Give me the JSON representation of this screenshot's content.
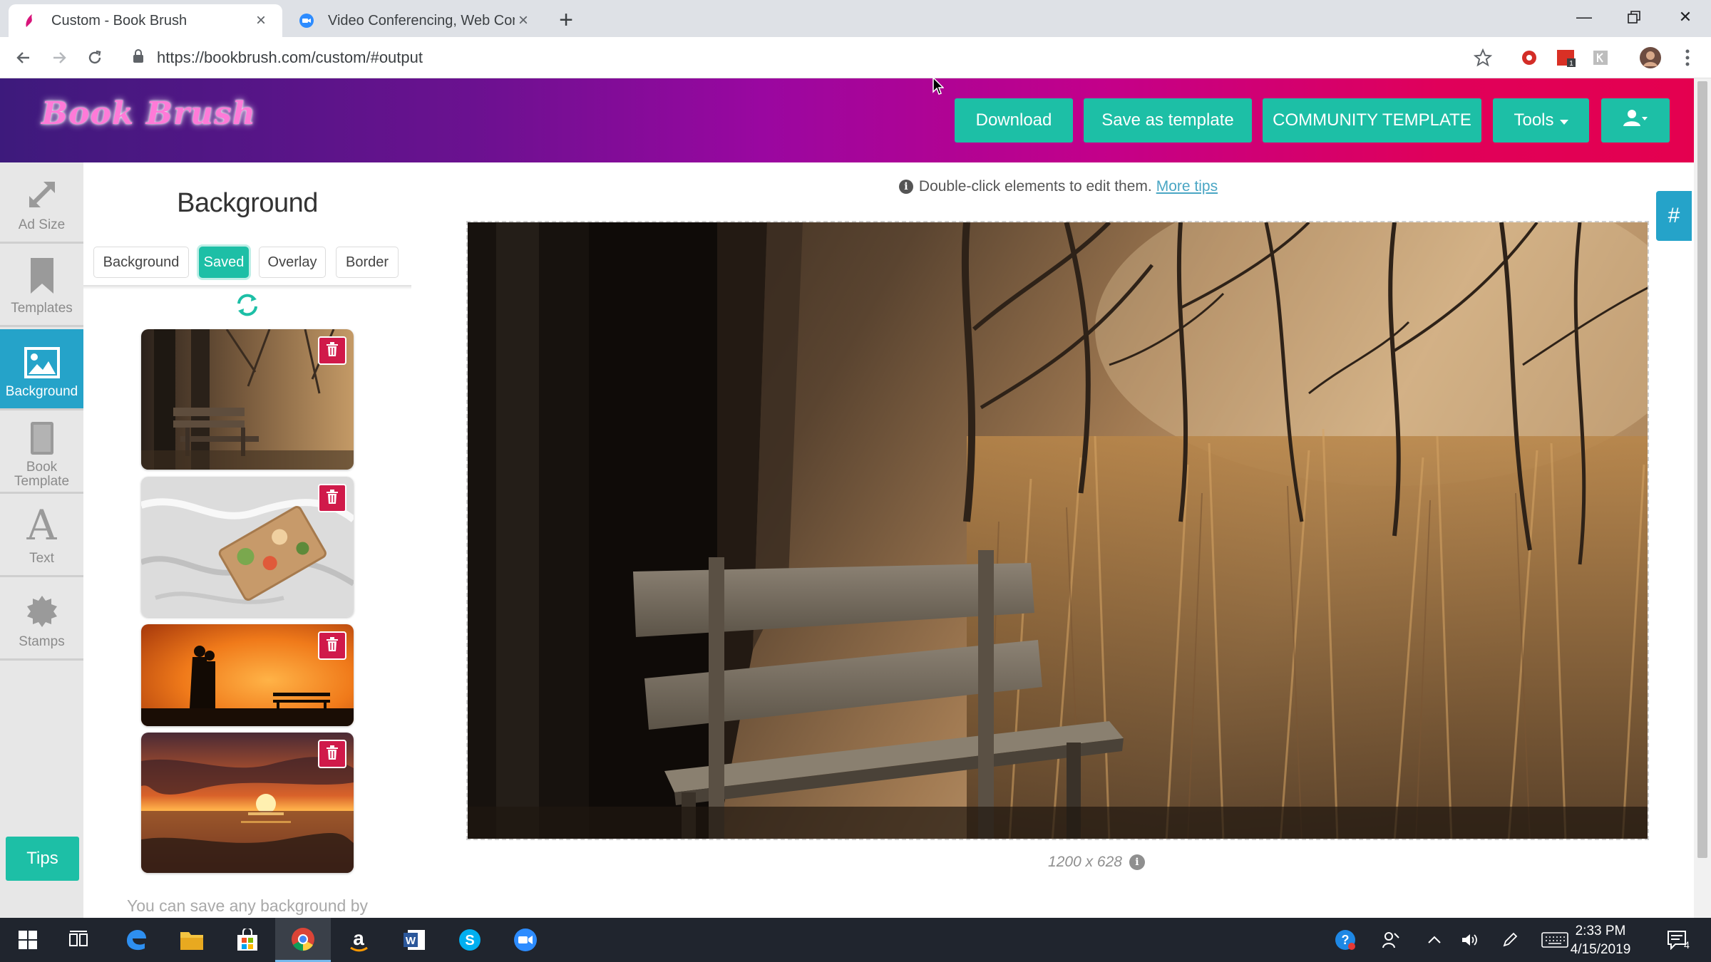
{
  "browser": {
    "tabs": [
      {
        "title": "Custom - Book Brush",
        "active": true
      },
      {
        "title": "Video Conferencing, Web Confer",
        "active": false
      }
    ],
    "url": "https://bookbrush.com/custom/#output"
  },
  "header": {
    "logo_text": "Book Brush",
    "buttons": {
      "download": "Download",
      "save_template": "Save as template",
      "community": "COMMUNITY TEMPLATE",
      "tools": "Tools"
    }
  },
  "rail": {
    "items": [
      {
        "label": "Ad Size",
        "icon": "resize-icon",
        "active": false
      },
      {
        "label": "Templates",
        "icon": "bookmark-icon",
        "active": false
      },
      {
        "label": "Background",
        "icon": "image-icon",
        "active": true
      },
      {
        "label": "Book Template",
        "icon": "book-icon",
        "active": false
      },
      {
        "label": "Text",
        "icon": "text-icon",
        "active": false
      },
      {
        "label": "Stamps",
        "icon": "stamp-icon",
        "active": false
      }
    ],
    "tips": "Tips"
  },
  "panel": {
    "title": "Background",
    "subtabs": [
      "Background",
      "Saved",
      "Overlay",
      "Border"
    ],
    "active_subtab": "Saved",
    "thumbnails": [
      {
        "name": "bench-forest"
      },
      {
        "name": "breakfast-tray-bed"
      },
      {
        "name": "couple-sunset-bench"
      },
      {
        "name": "ocean-sunset"
      }
    ],
    "hint": "You can save any background by"
  },
  "canvas": {
    "tip_text": "Double-click elements to edit them.",
    "tip_link": "More tips",
    "size_label": "1200 x 628",
    "hash_button": "#"
  },
  "taskbar": {
    "time": "2:33 PM",
    "date": "4/15/2019",
    "notification_count": "4"
  },
  "colors": {
    "accent": "#1dbfa6",
    "rail_active": "#25a3c9",
    "delete": "#d01a4a",
    "header_gradient_start": "#3d1a7c",
    "header_gradient_end": "#e4004f"
  }
}
